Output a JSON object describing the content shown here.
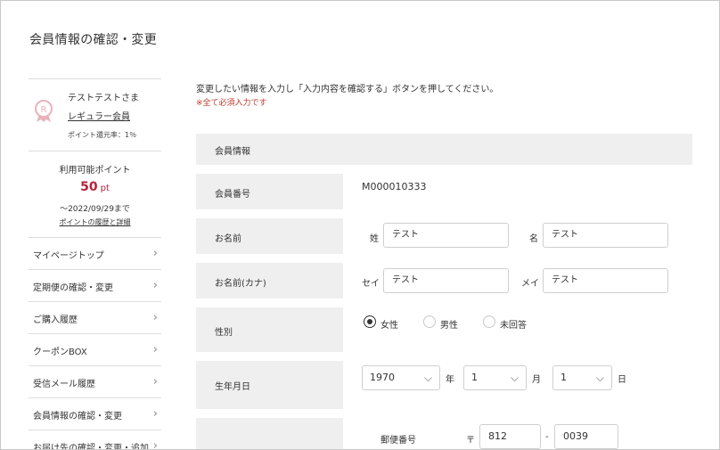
{
  "page_title": "会員情報の確認・変更",
  "sidebar": {
    "member_name": "テストテストさま",
    "member_rank": "レギュラー会員",
    "point_rate": "ポイント還元率：1％",
    "points_label": "利用可能ポイント",
    "points_value": "50",
    "points_unit": "pt",
    "points_expiry": "～2022/09/29まで",
    "points_link": "ポイントの履歴と詳細",
    "menu": [
      {
        "label": "マイページトップ"
      },
      {
        "label": "定期便の確認・変更"
      },
      {
        "label": "ご購入履歴"
      },
      {
        "label": "クーポンBOX"
      },
      {
        "label": "受信メール履歴"
      },
      {
        "label": "会員情報の確認・変更"
      },
      {
        "label": "お届け先の確認・変更・追加"
      }
    ],
    "chevron": "›"
  },
  "main": {
    "intro": "変更したい情報を入力し「入力内容を確認する」ボタンを押してください。",
    "required_note": "※全て必須入力です",
    "section_title": "会員情報",
    "member_no_label": "会員番号",
    "member_no_value": "M000010333",
    "name_label": "お名前",
    "last_name_label": "姓",
    "last_name_value": "テスト",
    "first_name_label": "名",
    "first_name_value": "テスト",
    "kana_label": "お名前(カナ)",
    "last_kana_label": "セイ",
    "last_kana_value": "テスト",
    "first_kana_label": "メイ",
    "first_kana_value": "テスト",
    "gender_label": "性別",
    "gender_options": [
      "女性",
      "男性",
      "未回答"
    ],
    "gender_selected": "女性",
    "birth_label": "生年月日",
    "birth_year": "1970",
    "birth_year_unit": "年",
    "birth_month": "1",
    "birth_month_unit": "月",
    "birth_day": "1",
    "birth_day_unit": "日",
    "postal_label": "郵便番号",
    "postal_mark": "〒",
    "postal_1": "812",
    "postal_sep": "-",
    "postal_2": "0039"
  },
  "colors": {
    "accent": "#b3243a",
    "required": "#c0392b",
    "label_bg": "#efefef"
  },
  "icons": {
    "badge": "rank-badge-icon",
    "chevron": "chevron-right-icon",
    "caret": "chevron-down-icon"
  }
}
